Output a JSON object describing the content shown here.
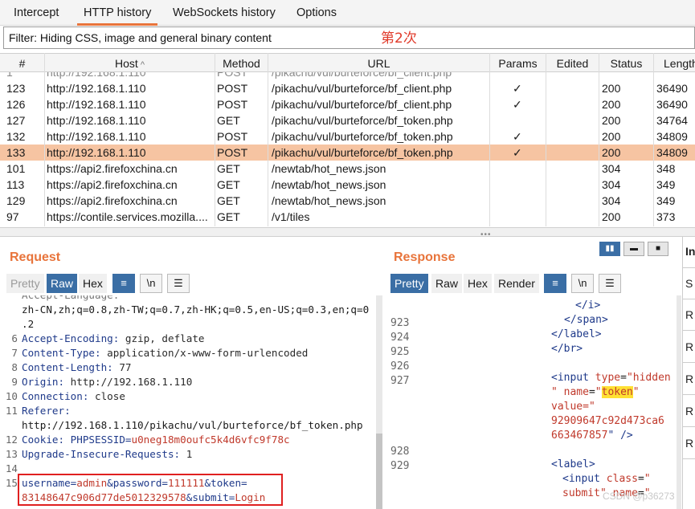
{
  "tabs": [
    "Intercept",
    "HTTP history",
    "WebSockets history",
    "Options"
  ],
  "filter": "Filter: Hiding CSS, image and general binary content",
  "annotation": "第2次",
  "columns": [
    "#",
    "Host",
    "Method",
    "URL",
    "Params",
    "Edited",
    "Status",
    "Length"
  ],
  "sort_icon": "chevron-up-icon",
  "rows": [
    {
      "id": "123",
      "host": "http://192.168.1.110",
      "method": "POST",
      "url": "/pikachu/vul/burteforce/bf_client.php",
      "params": "✓",
      "status": "200",
      "length": "36490"
    },
    {
      "id": "126",
      "host": "http://192.168.1.110",
      "method": "POST",
      "url": "/pikachu/vul/burteforce/bf_client.php",
      "params": "✓",
      "status": "200",
      "length": "36490"
    },
    {
      "id": "127",
      "host": "http://192.168.1.110",
      "method": "GET",
      "url": "/pikachu/vul/burteforce/bf_token.php",
      "params": "",
      "status": "200",
      "length": "34764"
    },
    {
      "id": "132",
      "host": "http://192.168.1.110",
      "method": "POST",
      "url": "/pikachu/vul/burteforce/bf_token.php",
      "params": "✓",
      "status": "200",
      "length": "34809"
    },
    {
      "id": "133",
      "host": "http://192.168.1.110",
      "method": "POST",
      "url": "/pikachu/vul/burteforce/bf_token.php",
      "params": "✓",
      "status": "200",
      "length": "34809"
    },
    {
      "id": "101",
      "host": "https://api2.firefoxchina.cn",
      "method": "GET",
      "url": "/newtab/hot_news.json",
      "params": "",
      "status": "304",
      "length": "348"
    },
    {
      "id": "113",
      "host": "https://api2.firefoxchina.cn",
      "method": "GET",
      "url": "/newtab/hot_news.json",
      "params": "",
      "status": "304",
      "length": "349"
    },
    {
      "id": "129",
      "host": "https://api2.firefoxchina.cn",
      "method": "GET",
      "url": "/newtab/hot_news.json",
      "params": "",
      "status": "304",
      "length": "349"
    },
    {
      "id": "97",
      "host": "https://contile.services.mozilla....",
      "method": "GET",
      "url": "/v1/tiles",
      "params": "",
      "status": "200",
      "length": "373"
    }
  ],
  "selected_row": "133",
  "request": {
    "title": "Request",
    "buttons": [
      "Pretty",
      "Raw",
      "Hex"
    ],
    "active": "Raw",
    "wrap_label": "\\n",
    "lines": [
      {
        "n": "",
        "text": "zh-CN,zh;q=0.8,zh-TW;q=0.7,zh-HK;q=0.5,en-US;q=0.3,en;q=0"
      },
      {
        "n": "",
        "text": ".2"
      },
      {
        "n": "6",
        "name": "Accept-Encoding",
        "value": " gzip, deflate"
      },
      {
        "n": "7",
        "name": "Content-Type",
        "value": " application/x-www-form-urlencoded"
      },
      {
        "n": "8",
        "name": "Content-Length",
        "value": " 77"
      },
      {
        "n": "9",
        "name": "Origin",
        "value": " http://192.168.1.110"
      },
      {
        "n": "10",
        "name": "Connection",
        "value": " close"
      },
      {
        "n": "11",
        "name": "Referer",
        "value": ""
      },
      {
        "n": "",
        "text": "http://192.168.1.110/pikachu/vul/burteforce/bf_token.php"
      },
      {
        "n": "12",
        "name": "Cookie",
        "value": " PHPSESSID=u0neg18m0oufc5k4d6vfc9f78c"
      },
      {
        "n": "13",
        "name": "Upgrade-Insecure-Requests",
        "value": " 1"
      },
      {
        "n": "14",
        "text": ""
      },
      {
        "n": "15",
        "body1": "username=admin&password=111111&token="
      },
      {
        "n": "",
        "body2": "83148647c906d77de5012329578&submit=Login"
      }
    ]
  },
  "response": {
    "title": "Response",
    "buttons": [
      "Pretty",
      "Raw",
      "Hex",
      "Render"
    ],
    "active": "Pretty",
    "wrap_label": "\\n",
    "line_numbers": [
      "923",
      "924",
      "925",
      "926",
      "927",
      "928",
      "929"
    ],
    "token_value": "92909647c92d473ca6663467857"
  },
  "inspector_letters": [
    "In",
    "S",
    "R",
    "R",
    "R",
    "R",
    "R"
  ],
  "watermark": "CSDN @p36273"
}
